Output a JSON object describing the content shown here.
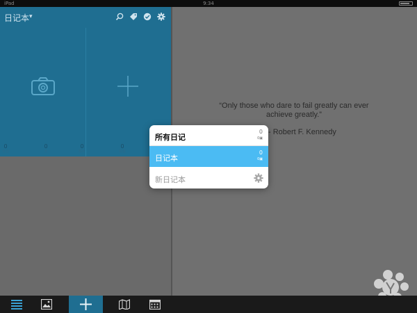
{
  "status_bar": {
    "carrier": "iPad",
    "time": "9:34",
    "battery": "battery-icon"
  },
  "header": {
    "journal_title": "日记本",
    "caret_icon": "chevron-down-icon",
    "icons": [
      "search-icon",
      "tag-icon",
      "check-circle-icon",
      "gear-icon"
    ]
  },
  "grid": {
    "camera_icon": "camera-icon",
    "add_icon": "plus-icon"
  },
  "stats": [
    {
      "value": "0",
      "label": "日记"
    },
    {
      "value": "0",
      "label": "天"
    },
    {
      "value": "0",
      "label": "照片"
    },
    {
      "value": "0",
      "label": "标签"
    }
  ],
  "quote": {
    "text": "“Only those who dare to fail greatly can ever achieve greatly.”",
    "author": "- Robert F. Kennedy"
  },
  "journal_menu": {
    "items": [
      {
        "label": "所有日记",
        "count": "0",
        "photos": "0"
      },
      {
        "label": "日记本",
        "count": "0",
        "photos": "0"
      },
      {
        "label": "新日记本"
      }
    ],
    "selected_color": "#4bbbf3"
  },
  "tab_bar": {
    "tabs": [
      "list-icon",
      "photos-icon",
      "add-entry-icon",
      "map-icon",
      "calendar-icon"
    ],
    "active_color": "#1f6e91"
  },
  "colors": {
    "panel_blue": "#1f6e91",
    "overlay_gray": "#6f6f6f"
  }
}
